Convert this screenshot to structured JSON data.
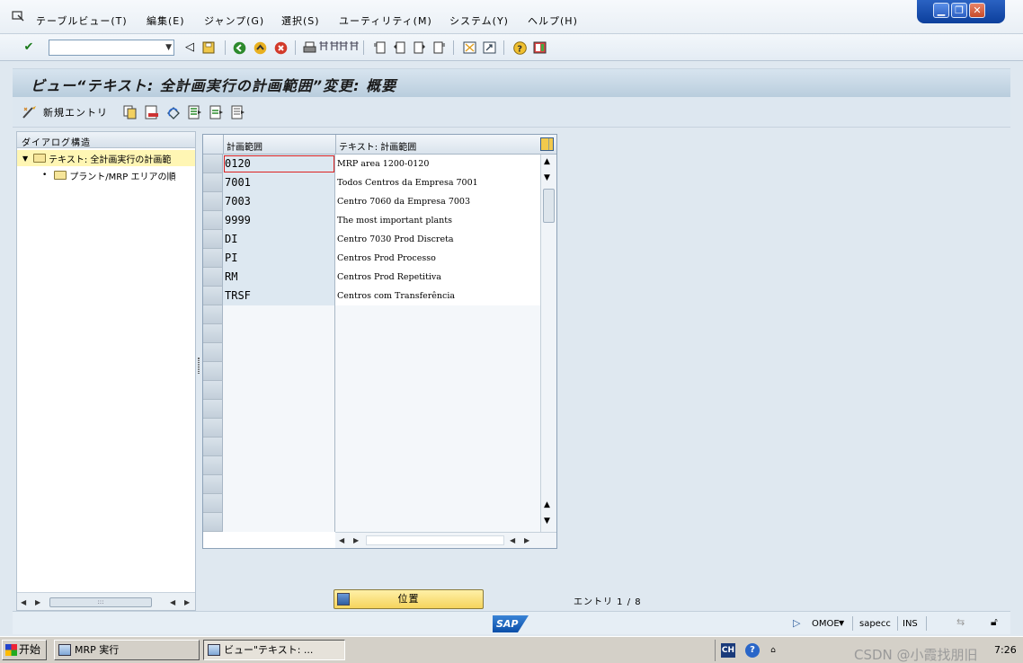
{
  "menubar": {
    "items": [
      "テーブルビュー(T)",
      "編集(E)",
      "ジャンプ(G)",
      "選択(S)",
      "ユーティリティ(M)",
      "システム(Y)",
      "ヘルプ(H)"
    ]
  },
  "window_controls": {
    "minimize": "▁",
    "restore": "❐",
    "close": "✕"
  },
  "command_field": {
    "value": ""
  },
  "title": "ビュー“テキスト: 全計画実行の計画範囲”変更: 概要",
  "app_toolbar": {
    "new_entries_label": "新規エントリ"
  },
  "tree": {
    "header": "ダイアログ構造",
    "root": "テキスト: 全計画実行の計画範",
    "child": "プラント/MRP エリアの順"
  },
  "table": {
    "headers": [
      "計画範囲",
      "テキスト: 計画範囲"
    ],
    "rows": [
      [
        "0120",
        "MRP area 1200-0120"
      ],
      [
        "7001",
        "Todos Centros da Empresa 7001"
      ],
      [
        "7003",
        "Centro 7060 da Empresa 7003"
      ],
      [
        "9999",
        "The most important plants"
      ],
      [
        "DI",
        "Centro 7030 Prod Discreta"
      ],
      [
        "PI",
        "Centros Prod Processo"
      ],
      [
        "RM",
        "Centros Prod Repetitiva"
      ],
      [
        "TRSF",
        "Centros com Transferência"
      ]
    ],
    "empty_rows": 12
  },
  "position_button": "位置",
  "entries_label": "エントリ 1 / 8",
  "statusbar": {
    "sap": "SAP",
    "transaction": "OMOE",
    "system": "sapecc",
    "mode": "INS"
  },
  "taskbar": {
    "start": "开始",
    "tasks": [
      "MRP 実行",
      "ビュー\"テキスト: ..."
    ],
    "lang": "CH",
    "watermark": "CSDN @小霞找朋旧",
    "clock": "7:26"
  }
}
